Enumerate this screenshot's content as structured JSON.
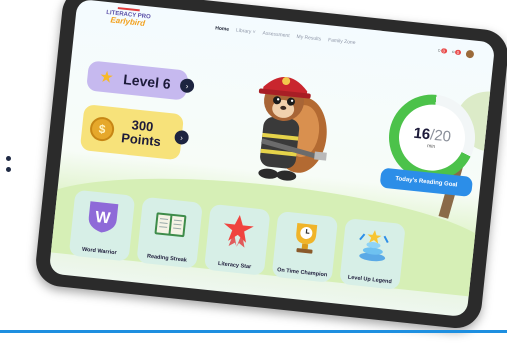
{
  "logo": {
    "line1": "LITERACY PRO",
    "line2": "Earlybird"
  },
  "nav": {
    "items": [
      {
        "label": "Home",
        "active": true
      },
      {
        "label": "Library ˅",
        "active": false
      },
      {
        "label": "Assessment",
        "active": false
      },
      {
        "label": "My Results",
        "active": false
      },
      {
        "label": "Family Zone",
        "active": false
      }
    ],
    "badge_count_1": "0",
    "badge_count_2": "0"
  },
  "level": {
    "label": "Level 6",
    "icon": "star-icon"
  },
  "points": {
    "value": "300",
    "label": "Points",
    "icon": "coin-icon"
  },
  "reading_goal": {
    "current": "16",
    "separator": "/",
    "target": "20",
    "unit": "min",
    "label": "Today's Reading Goal",
    "progress": 0.8
  },
  "achievements": [
    {
      "label": "Word Warrior",
      "icon": "w-shield-icon"
    },
    {
      "label": "Reading Streak",
      "icon": "open-book-icon"
    },
    {
      "label": "Literacy Star",
      "icon": "star-ribbon-icon"
    },
    {
      "label": "On Time Champion",
      "icon": "trophy-clock-icon"
    },
    {
      "label": "Level Up Legend",
      "icon": "stacked-rings-icon"
    }
  ],
  "colors": {
    "accent_blue": "#2c8ee8",
    "goal_green": "#4cc24a",
    "level_purple": "#c6b9ef",
    "points_yellow": "#f7e27a"
  }
}
